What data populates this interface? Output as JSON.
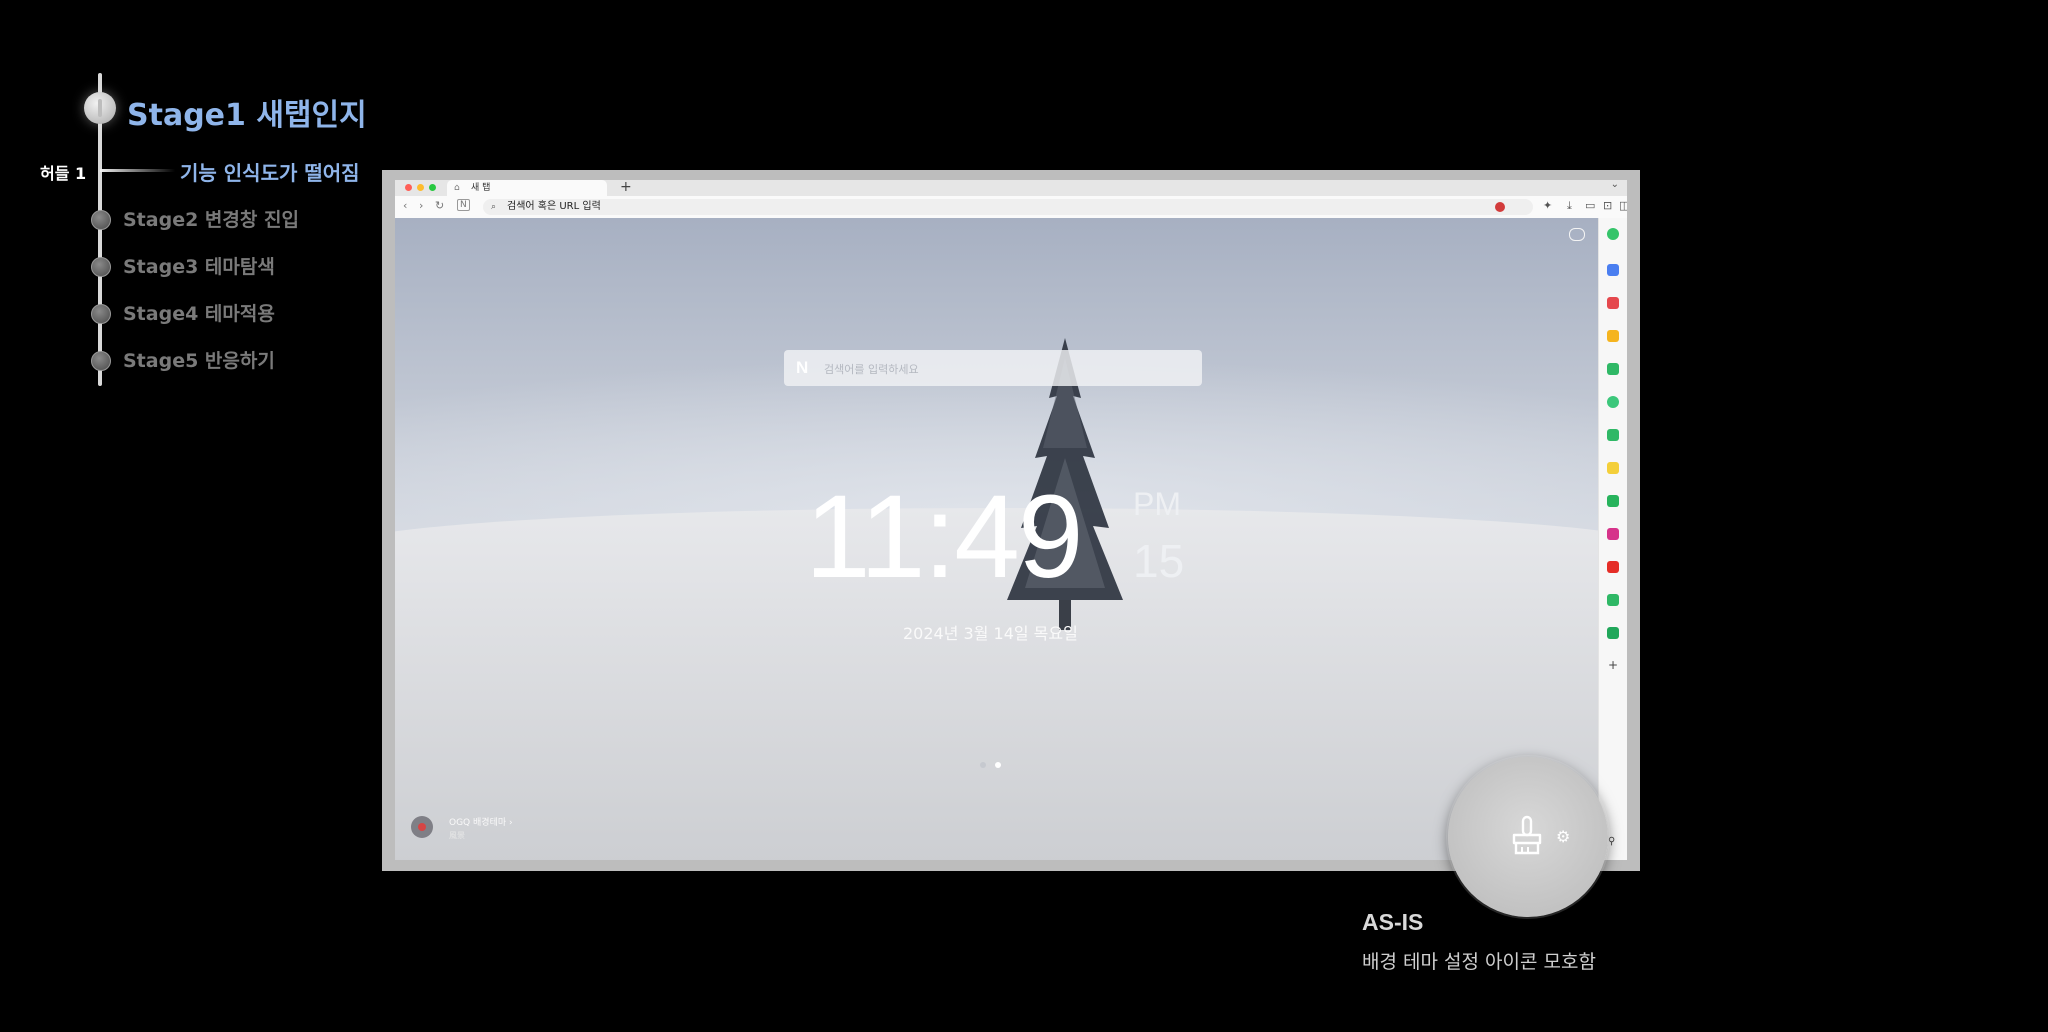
{
  "timeline": {
    "stages": [
      {
        "label": "Stage1 새탭인지",
        "active": true
      },
      {
        "label": "Stage2 변경창 진입",
        "active": false
      },
      {
        "label": "Stage3 테마탐색",
        "active": false
      },
      {
        "label": "Stage4 테마적용",
        "active": false
      },
      {
        "label": "Stage5 반응하기",
        "active": false
      }
    ],
    "hurdle": {
      "label": "허들 1",
      "description": "기능 인식도가 떨어짐"
    },
    "colors": {
      "active": "#8fb5ea",
      "inactive": "#7a7a7a"
    }
  },
  "browser": {
    "tab_title": "새 탭",
    "new_tab_icon": "+",
    "address_placeholder": "검색어 혹은 URL 입력",
    "search_placeholder": "검색어를 입력하세요",
    "search_logo": "N",
    "clock": {
      "time": "11:49",
      "ampm": "PM",
      "seconds": "15"
    },
    "date": "2024년 3월 14일 목요일",
    "credit": {
      "title": "OGQ 배경테마  ›",
      "subtitle": "風景"
    },
    "page_indicator": {
      "total": 2,
      "active": 2
    },
    "sidebar_icons": [
      {
        "name": "green-circle-icon",
        "color": "#35c46a"
      },
      {
        "name": "blue-app-icon",
        "color": "#4a7ef0"
      },
      {
        "name": "pocket-icon",
        "color": "#e5484d"
      },
      {
        "name": "star-icon",
        "color": "#f5b41f"
      },
      {
        "name": "translate-icon",
        "color": "#2fb866"
      },
      {
        "name": "play-circle-icon",
        "color": "#3cc77b"
      },
      {
        "name": "calendar-icon",
        "color": "#2fb866"
      },
      {
        "name": "note-icon",
        "color": "#f4cf3a"
      },
      {
        "name": "play-store-icon",
        "color": "#27b35c"
      },
      {
        "name": "instagram-icon",
        "color": "#d6338a"
      },
      {
        "name": "youtube-icon",
        "color": "#e52d27"
      },
      {
        "name": "game-icon",
        "color": "#2fb866"
      },
      {
        "name": "whale-icon",
        "color": "#20a75a"
      }
    ]
  },
  "note": {
    "title": "AS-IS",
    "description": "배경 테마 설정 아이콘 모호함"
  }
}
